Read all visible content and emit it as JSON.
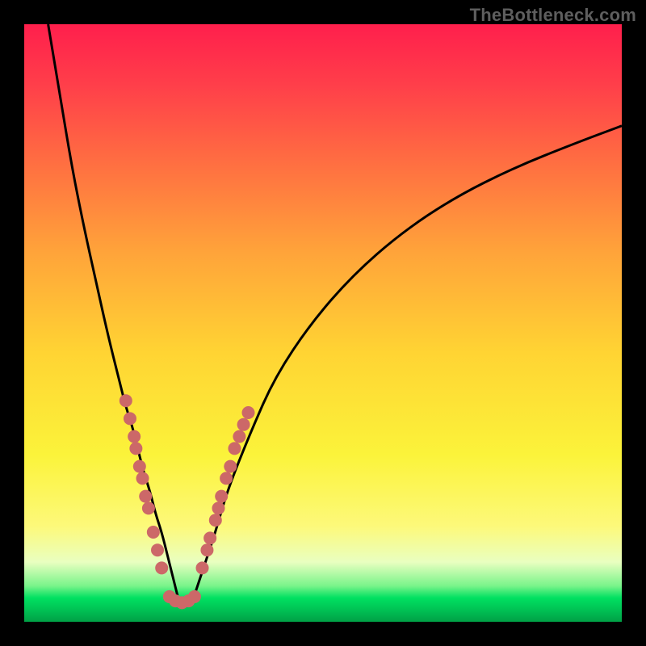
{
  "watermark": "TheBottleneck.com",
  "chart_data": {
    "type": "line",
    "title": "",
    "xlabel": "",
    "ylabel": "",
    "xlim": [
      0,
      100
    ],
    "ylim": [
      0,
      100
    ],
    "series": [
      {
        "name": "curve-left",
        "x": [
          4,
          6,
          8,
          10,
          12,
          14,
          16,
          17,
          18,
          19,
          20,
          21,
          22,
          23,
          24,
          25,
          26
        ],
        "y": [
          100,
          88,
          76,
          66,
          57,
          48,
          40,
          36,
          33,
          29,
          25,
          22,
          18,
          15,
          11,
          7,
          3
        ]
      },
      {
        "name": "curve-right",
        "x": [
          28,
          30,
          32,
          34,
          38,
          42,
          48,
          55,
          63,
          72,
          82,
          92,
          100
        ],
        "y": [
          3,
          9,
          15,
          22,
          32,
          41,
          50,
          58,
          65,
          71,
          76,
          80,
          83
        ]
      }
    ],
    "dots": {
      "name": "markers",
      "color": "#cc6868",
      "radius_px": 8,
      "points": [
        {
          "x": 17.0,
          "y": 37
        },
        {
          "x": 17.7,
          "y": 34
        },
        {
          "x": 18.4,
          "y": 31
        },
        {
          "x": 18.7,
          "y": 29
        },
        {
          "x": 19.3,
          "y": 26
        },
        {
          "x": 19.8,
          "y": 24
        },
        {
          "x": 20.3,
          "y": 21
        },
        {
          "x": 20.8,
          "y": 19
        },
        {
          "x": 21.6,
          "y": 15
        },
        {
          "x": 22.3,
          "y": 12
        },
        {
          "x": 23.0,
          "y": 9
        },
        {
          "x": 29.8,
          "y": 9
        },
        {
          "x": 30.6,
          "y": 12
        },
        {
          "x": 31.1,
          "y": 14
        },
        {
          "x": 32.0,
          "y": 17
        },
        {
          "x": 32.5,
          "y": 19
        },
        {
          "x": 33.0,
          "y": 21
        },
        {
          "x": 33.8,
          "y": 24
        },
        {
          "x": 34.5,
          "y": 26
        },
        {
          "x": 35.2,
          "y": 29
        },
        {
          "x": 36.0,
          "y": 31
        },
        {
          "x": 36.7,
          "y": 33
        },
        {
          "x": 37.5,
          "y": 35
        },
        {
          "x": 24.3,
          "y": 4.2
        },
        {
          "x": 25.3,
          "y": 3.5
        },
        {
          "x": 26.4,
          "y": 3.2
        },
        {
          "x": 27.5,
          "y": 3.5
        },
        {
          "x": 28.5,
          "y": 4.2
        }
      ]
    }
  }
}
